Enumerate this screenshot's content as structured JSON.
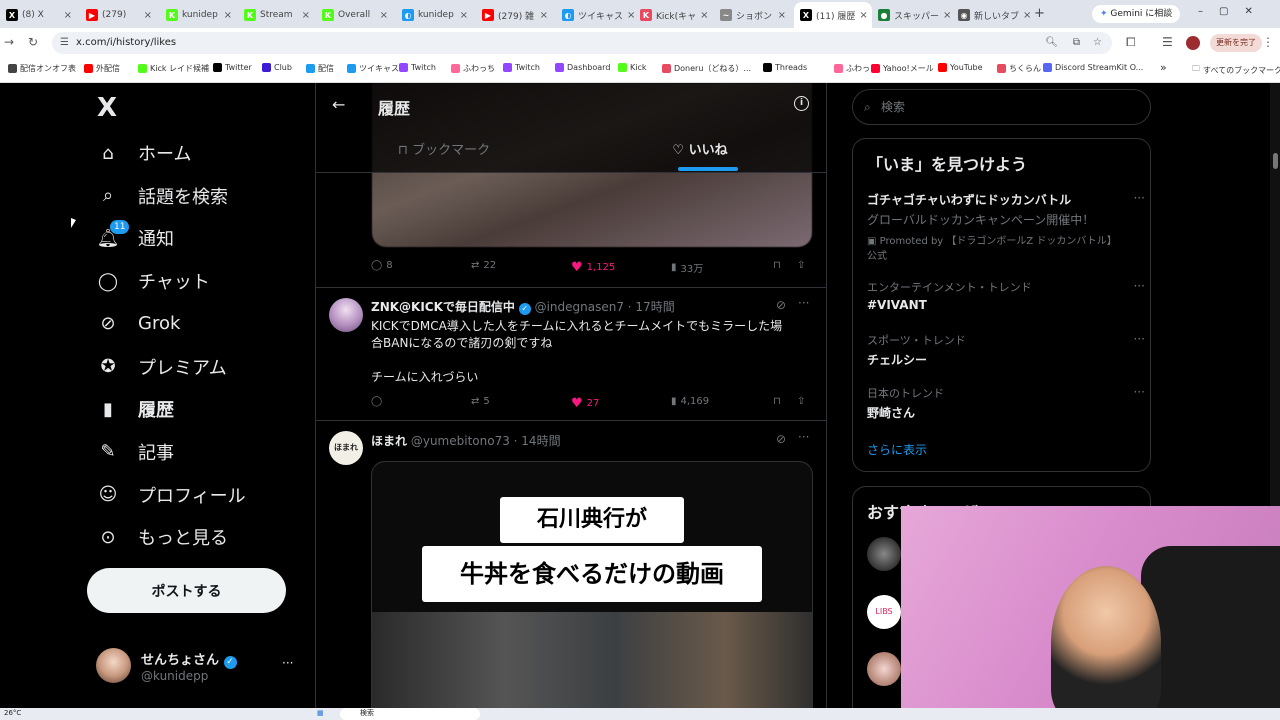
{
  "browser": {
    "tabs": [
      {
        "label": "(8) X",
        "color": "#000000",
        "glyph": "X"
      },
      {
        "label": "(279)",
        "color": "#ff0000",
        "glyph": "▶"
      },
      {
        "label": "kunidep",
        "color": "#53fc18",
        "glyph": "K"
      },
      {
        "label": "Stream",
        "color": "#53fc18",
        "glyph": "K"
      },
      {
        "label": "Overall",
        "color": "#53fc18",
        "glyph": "K"
      },
      {
        "label": "kunidep",
        "color": "#1d9bf0",
        "glyph": "◐"
      },
      {
        "label": "(279) 雑",
        "color": "#ff0000",
        "glyph": "▶"
      },
      {
        "label": "ツイキャス",
        "color": "#1d9bf0",
        "glyph": "◐"
      },
      {
        "label": "Kick(キャ",
        "color": "#e84a5f",
        "glyph": "K"
      },
      {
        "label": "ショボン",
        "color": "#888888",
        "glyph": "~"
      },
      {
        "label": "(11) 履歴",
        "color": "#000000",
        "glyph": "X"
      },
      {
        "label": "スキッパー",
        "color": "#1a7f37",
        "glyph": "●"
      },
      {
        "label": "新しいタブ",
        "color": "#555555",
        "glyph": "◉"
      }
    ],
    "new_tab_glyph": "+",
    "gemini_label": "Gemini に相談",
    "url": "x.com/i/history/likes",
    "update_label": "更新を完了",
    "bookmarks": [
      {
        "label": "配信オンオフ表",
        "color": "#444444"
      },
      {
        "label": "外配信",
        "color": "#ff0000"
      },
      {
        "label": "Kick レイド候補",
        "color": "#53fc18"
      },
      {
        "label": "Twitter",
        "color": "#000000"
      },
      {
        "label": "Club",
        "color": "#3b1dd6"
      },
      {
        "label": "配信",
        "color": "#1d9bf0"
      },
      {
        "label": "ツイキャス",
        "color": "#1d9bf0"
      },
      {
        "label": "Twitch",
        "color": "#9146ff"
      },
      {
        "label": "ふわっち",
        "color": "#ff6699"
      },
      {
        "label": "Twitch",
        "color": "#9146ff"
      },
      {
        "label": "Dashboard",
        "color": "#9146ff"
      },
      {
        "label": "Kick",
        "color": "#53fc18"
      },
      {
        "label": "Doneru（どねる）...",
        "color": "#e84a5f"
      },
      {
        "label": "Threads",
        "color": "#000000"
      },
      {
        "label": "ふわっち",
        "color": "#ff6699"
      },
      {
        "label": "Yahoo!メール",
        "color": "#ff0033"
      },
      {
        "label": "YouTube",
        "color": "#ff0000"
      },
      {
        "label": "ちくらん",
        "color": "#e84a5f"
      },
      {
        "label": "Discord StreamKit O...",
        "color": "#5865f2"
      }
    ],
    "bookmarks_more": "»",
    "all_bookmarks": "すべてのブックマーク"
  },
  "sidebar": {
    "logo": "X",
    "items": [
      {
        "label": "ホーム",
        "icon": "home-icon"
      },
      {
        "label": "話題を検索",
        "icon": "search-icon"
      },
      {
        "label": "通知",
        "icon": "bell-icon",
        "badge": "11"
      },
      {
        "label": "チャット",
        "icon": "chat-icon"
      },
      {
        "label": "Grok",
        "icon": "grok-icon"
      },
      {
        "label": "プレミアム",
        "icon": "premium-icon"
      },
      {
        "label": "履歴",
        "icon": "bookmark-icon"
      },
      {
        "label": "記事",
        "icon": "article-icon"
      },
      {
        "label": "プロフィール",
        "icon": "person-icon"
      },
      {
        "label": "もっと見る",
        "icon": "more-icon"
      }
    ],
    "post_button": "ポストする",
    "account": {
      "name": "せんちょさん",
      "handle": "@kunidepp",
      "more": "···"
    }
  },
  "main": {
    "title": "履歴",
    "tabs": [
      {
        "label": "ブックマーク"
      },
      {
        "label": "いいね"
      }
    ],
    "tweets": [
      {
        "replies": "8",
        "retweets": "22",
        "likes": "1,125",
        "views": "33万"
      },
      {
        "name": "ZNK@KICKで毎日配信中",
        "handle": "@indegnasen7",
        "time": "· 17時間",
        "text1": "KICKでDMCA導入した人をチームに入れるとチームメイトでもミラーした場",
        "text2": "合BANになるので諸刃の剣ですね",
        "text3": "チームに入れづらい",
        "replies": "",
        "retweets": "5",
        "likes": "27",
        "views": "4,169"
      },
      {
        "name": "ほまれ",
        "handle": "@yumebitono73",
        "time": "· 14時間",
        "avatar_text": "ほまれ",
        "caption1": "石川典行が",
        "caption2": "牛丼を食べるだけの動画"
      }
    ],
    "like_color": "#f91880"
  },
  "right": {
    "search_placeholder": "検索",
    "trends_title": "「いま」を見つけよう",
    "trends": [
      {
        "meta": "",
        "title": "ゴチャゴチャいわずにドッカンバトル",
        "sub": "グローバルドッカンキャンペーン開催中！",
        "promo": "Promoted by 【ドラゴンボールZ ドッカンバトル】",
        "promo2": "公式"
      },
      {
        "meta": "エンターテインメント・トレンド",
        "title": "#VIVANT"
      },
      {
        "meta": "スポーツ・トレンド",
        "title": "チェルシー"
      },
      {
        "meta": "日本のトレンド",
        "title": "野崎さん"
      }
    ],
    "show_more": "さらに表示",
    "who_to_follow_title": "おすすめユーザー"
  },
  "taskbar": {
    "weather": "26°C",
    "search": "検索"
  }
}
